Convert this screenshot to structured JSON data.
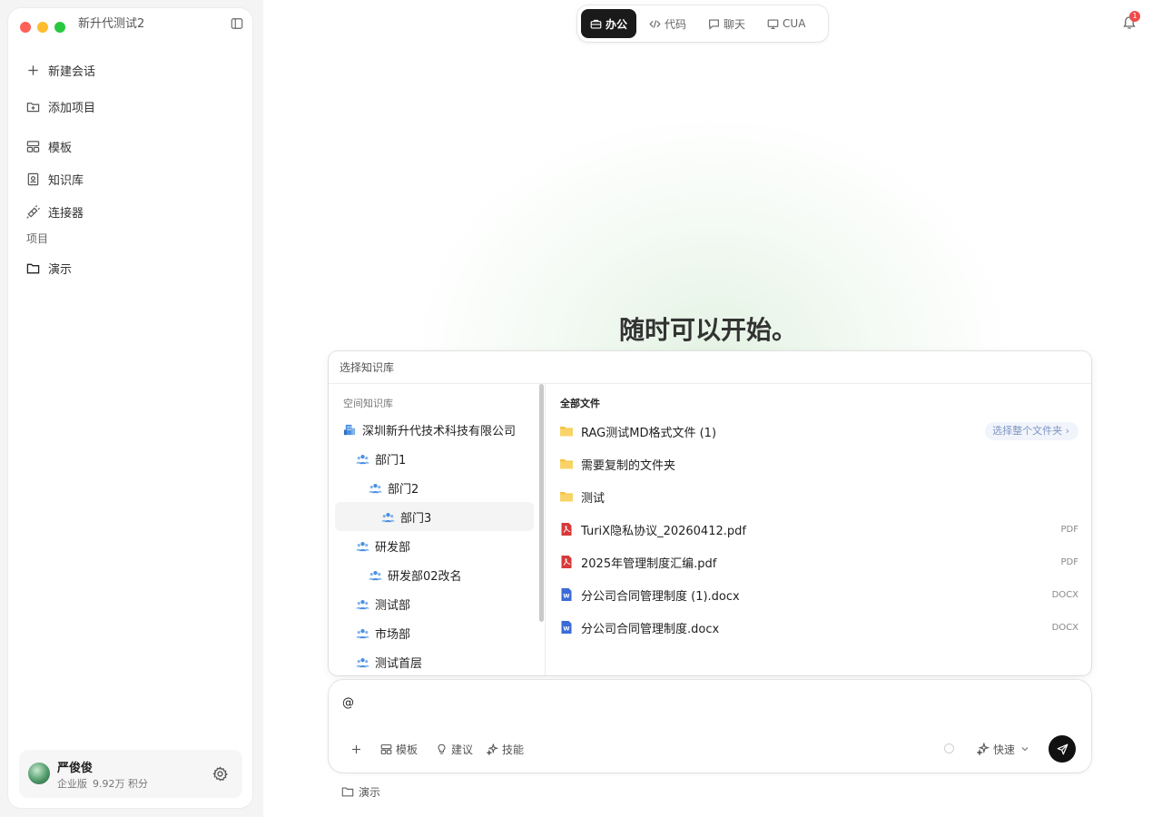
{
  "app": {
    "title": "新升代测试2"
  },
  "sidebar": {
    "items": [
      {
        "label": "新建会话",
        "icon": "plus-icon"
      },
      {
        "label": "添加项目",
        "icon": "folder-plus-icon"
      },
      {
        "label": "模板",
        "icon": "template-icon"
      },
      {
        "label": "知识库",
        "icon": "knowledge-base-icon"
      },
      {
        "label": "连接器",
        "icon": "plug-icon"
      }
    ],
    "section_label": "项目",
    "projects": [
      {
        "label": "演示",
        "icon": "folder-icon"
      }
    ]
  },
  "user": {
    "name": "严俊俊",
    "plan": "企业版",
    "points": "9.92万 积分"
  },
  "mode_tabs": [
    {
      "label": "办公",
      "icon": "briefcase-icon",
      "active": true
    },
    {
      "label": "代码",
      "icon": "code-icon",
      "active": false
    },
    {
      "label": "聊天",
      "icon": "chat-icon",
      "active": false
    },
    {
      "label": "CUA",
      "icon": "monitor-icon",
      "active": false
    }
  ],
  "notifications": {
    "count": "1"
  },
  "hero": {
    "title": "随时可以开始。"
  },
  "kb_picker": {
    "header": "选择知识库",
    "left_title": "空间知识库",
    "tree": [
      {
        "label": "深圳新升代技术科技有限公司",
        "level": 0,
        "icon": "company-icon"
      },
      {
        "label": "部门1",
        "level": 1,
        "icon": "team-icon"
      },
      {
        "label": "部门2",
        "level": 2,
        "icon": "team-icon"
      },
      {
        "label": "部门3",
        "level": 3,
        "icon": "team-icon",
        "selected": true
      },
      {
        "label": "研发部",
        "level": 1,
        "icon": "team-icon"
      },
      {
        "label": "研发部02改名",
        "level": 2,
        "icon": "team-icon"
      },
      {
        "label": "测试部",
        "level": 1,
        "icon": "team-icon"
      },
      {
        "label": "市场部",
        "level": 1,
        "icon": "team-icon"
      },
      {
        "label": "测试首层",
        "level": 1,
        "icon": "team-icon"
      }
    ],
    "right_title": "全部文件",
    "select_folder_label": "选择整个文件夹",
    "files": [
      {
        "name": "RAG测试MD格式文件 (1)",
        "kind": "folder",
        "type": ""
      },
      {
        "name": "需要复制的文件夹",
        "kind": "folder",
        "type": ""
      },
      {
        "name": "测试",
        "kind": "folder",
        "type": ""
      },
      {
        "name": "TuriX隐私协议_20260412.pdf",
        "kind": "pdf",
        "type": "PDF"
      },
      {
        "name": "2025年管理制度汇编.pdf",
        "kind": "pdf",
        "type": "PDF"
      },
      {
        "name": "分公司合同管理制度 (1).docx",
        "kind": "docx",
        "type": "DOCX"
      },
      {
        "name": "分公司合同管理制度.docx",
        "kind": "docx",
        "type": "DOCX"
      }
    ]
  },
  "composer": {
    "value": "@",
    "tools": [
      {
        "label": "",
        "icon": "plus-icon"
      },
      {
        "label": "模板",
        "icon": "template-icon"
      },
      {
        "label": "建议",
        "icon": "lightbulb-icon"
      },
      {
        "label": "技能",
        "icon": "sparkle-icon"
      }
    ],
    "speed": "快速"
  },
  "project_tag": "演示",
  "colors": {
    "accent_dark": "#1a1a1a",
    "pdf_red": "#d63a3a",
    "docx_blue": "#3a6bd6",
    "folder_yellow": "#f5c344",
    "team_blue": "#4a8fe0",
    "badge_red": "#ef4b4b"
  }
}
